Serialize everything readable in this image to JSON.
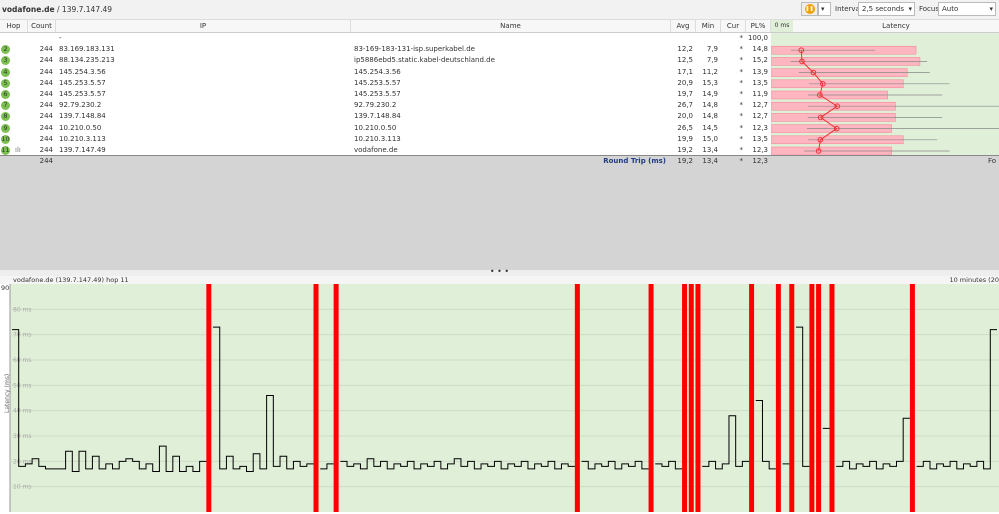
{
  "breadcrumb": {
    "host": "vodafone.de",
    "ip": "139.7.147.49"
  },
  "toolbar": {
    "interval_label": "Interval",
    "interval_value": "2,5 seconds",
    "focus_label": "Focus",
    "focus_value": "Auto",
    "pause_icon": "pause-icon"
  },
  "columns": {
    "hop": "Hop",
    "count": "Count",
    "ip": "IP",
    "name": "Name",
    "avg": "Avg",
    "min": "Min",
    "cur": "Cur",
    "pl": "PL%",
    "latency_scale": "0 ms",
    "latency": "Latency"
  },
  "hops": [
    {
      "hop": "",
      "count": "",
      "ip": "-",
      "name": "",
      "avg": "",
      "min": "",
      "cur": "*",
      "pl": "100,0"
    },
    {
      "hop": "2",
      "count": "244",
      "ip": "83.169.183.131",
      "name": "83-169-183-131-isp.superkabel.de",
      "avg": "12,2",
      "min": "7,9",
      "cur": "*",
      "pl": "14,8",
      "max": 42
    },
    {
      "hop": "3",
      "count": "244",
      "ip": "88.134.235.213",
      "name": "ip5886ebd5.static.kabel-deutschland.de",
      "avg": "12,5",
      "min": "7,9",
      "cur": "*",
      "pl": "15,2",
      "max": 63
    },
    {
      "hop": "4",
      "count": "244",
      "ip": "145.254.3.56",
      "name": "145.254.3.56",
      "avg": "17,1",
      "min": "11,2",
      "cur": "*",
      "pl": "13,9",
      "max": 64
    },
    {
      "hop": "5",
      "count": "244",
      "ip": "145.253.5.57",
      "name": "145.253.5.57",
      "avg": "20,9",
      "min": "15,3",
      "cur": "*",
      "pl": "13,5",
      "max": 72
    },
    {
      "hop": "6",
      "count": "244",
      "ip": "145.253.5.57",
      "name": "145.253.5.57",
      "avg": "19,7",
      "min": "14,9",
      "cur": "*",
      "pl": "11,9",
      "max": 69
    },
    {
      "hop": "7",
      "count": "244",
      "ip": "92.79.230.2",
      "name": "92.79.230.2",
      "avg": "26,7",
      "min": "14,8",
      "cur": "*",
      "pl": "12,7",
      "max": 95
    },
    {
      "hop": "8",
      "count": "244",
      "ip": "139.7.148.84",
      "name": "139.7.148.84",
      "avg": "20,0",
      "min": "14,8",
      "cur": "*",
      "pl": "12,7",
      "max": 69
    },
    {
      "hop": "9",
      "count": "244",
      "ip": "10.210.0.50",
      "name": "10.210.0.50",
      "avg": "26,5",
      "min": "14,5",
      "cur": "*",
      "pl": "12,3",
      "max": 95
    },
    {
      "hop": "10",
      "count": "244",
      "ip": "10.210.3.113",
      "name": "10.210.3.113",
      "avg": "19,9",
      "min": "15,0",
      "cur": "*",
      "pl": "13,5",
      "max": 67
    },
    {
      "hop": "11",
      "count": "244",
      "ip": "139.7.147.49",
      "name": "vodafone.de",
      "avg": "19,2",
      "min": "13,4",
      "cur": "*",
      "pl": "12,3",
      "max": 72
    }
  ],
  "summary": {
    "count": "244",
    "label": "Round Trip (ms)",
    "avg": "19,2",
    "min": "13,4",
    "cur": "*",
    "pl": "12,3",
    "focus": "Fo"
  },
  "splitter": "• • •",
  "chart_data": {
    "type": "line",
    "title": "vodafone.de (139.7.147.49) hop 11",
    "timespan": "10 minutes (20",
    "ylabel": "Latency (ms)",
    "ylim": [
      0,
      90
    ],
    "ytop_label": "90",
    "yticks": [
      "10 ms",
      "20 ms",
      "30 ms",
      "40 ms",
      "50 ms",
      "60 ms",
      "70 ms",
      "80 ms"
    ],
    "grid": true,
    "colors": {
      "background": "#e0efd8",
      "loss": "#ff0000",
      "line": "#000000"
    },
    "samples": [
      72,
      18,
      19,
      21,
      18,
      17,
      17,
      17,
      24,
      16,
      24,
      17,
      22,
      17,
      19,
      17,
      20,
      21,
      20,
      17,
      19,
      16,
      26,
      16,
      22,
      16,
      18,
      16,
      20,
      null,
      73,
      17,
      22,
      17,
      18,
      16,
      23,
      17,
      46,
      18,
      22,
      17,
      20,
      18,
      19,
      null,
      17,
      19,
      null,
      20,
      18,
      19,
      17,
      21,
      18,
      20,
      17,
      19,
      18,
      20,
      17,
      19,
      18,
      20,
      17,
      19,
      21,
      18,
      20,
      17,
      19,
      18,
      20,
      17,
      19,
      18,
      20,
      17,
      19,
      18,
      20,
      17,
      19,
      18,
      null,
      20,
      17,
      19,
      18,
      20,
      17,
      19,
      18,
      20,
      17,
      null,
      19,
      18,
      20,
      17,
      null,
      null,
      null,
      18,
      20,
      17,
      19,
      38,
      18,
      20,
      null,
      44,
      20,
      17,
      null,
      19,
      null,
      73,
      18,
      null,
      null,
      33,
      null,
      18,
      20,
      17,
      19,
      18,
      20,
      17,
      19,
      18,
      20,
      37,
      null,
      18,
      20,
      17,
      19,
      18,
      20,
      17,
      19,
      18,
      20,
      17,
      72
    ]
  }
}
